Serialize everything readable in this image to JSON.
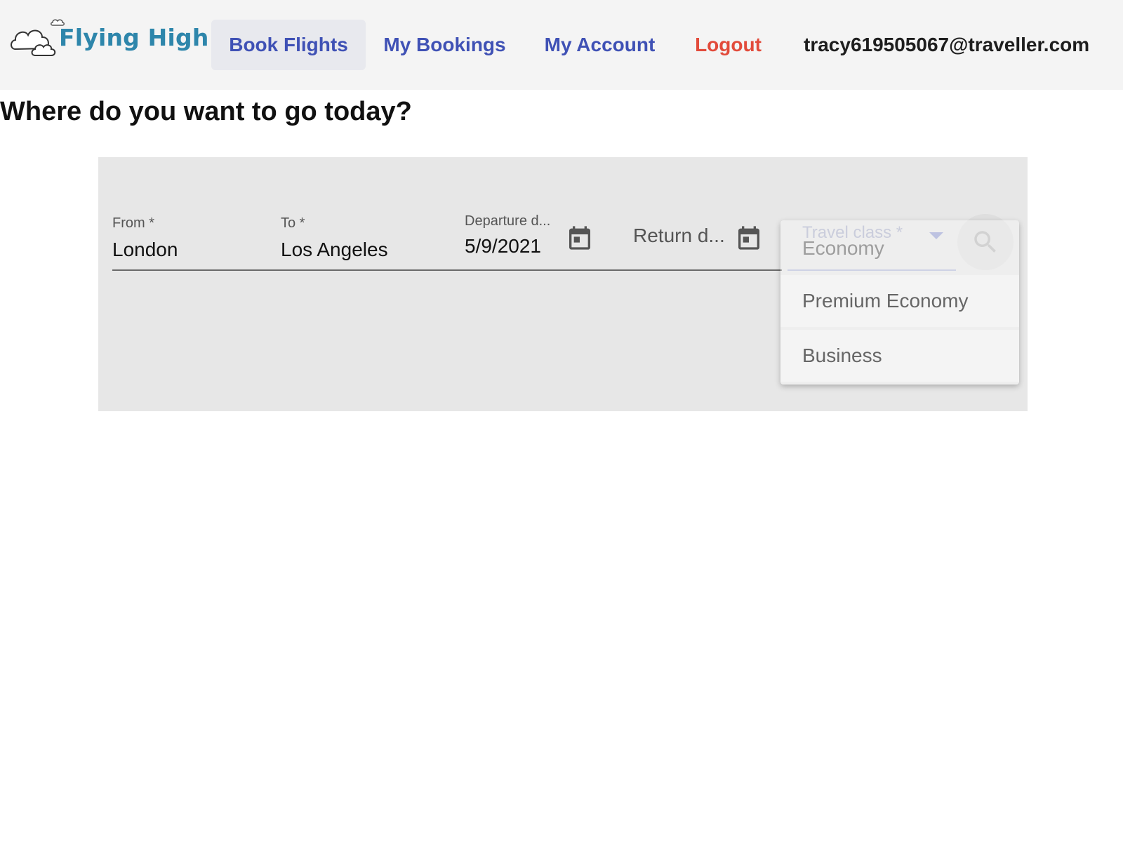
{
  "brand": {
    "name": "Flying High"
  },
  "nav": {
    "items": [
      {
        "label": "Book Flights",
        "active": true
      },
      {
        "label": "My Bookings"
      },
      {
        "label": "My Account"
      },
      {
        "label": "Logout",
        "color": "#e24b3b"
      }
    ],
    "user_email": "tracy619505067@traveller.com"
  },
  "page": {
    "title": "Where do you want to go today?"
  },
  "search": {
    "from": {
      "label": "From *",
      "value": "London"
    },
    "to": {
      "label": "To *",
      "value": "Los Angeles"
    },
    "departure": {
      "label": "Departure d...",
      "value": "5/9/2021",
      "icon": "calendar-icon"
    },
    "return": {
      "placeholder": "Return d...",
      "icon": "calendar-icon"
    },
    "travel_class": {
      "label": "Travel class *",
      "value": "Economy",
      "options": [
        "Premium Economy",
        "Business"
      ],
      "open": true
    },
    "search_icon": "search-icon"
  },
  "colors": {
    "accent": "#3f51b5",
    "logout": "#e24b3b",
    "brand": "#2e86ab",
    "panel": "#e7e7e7"
  }
}
